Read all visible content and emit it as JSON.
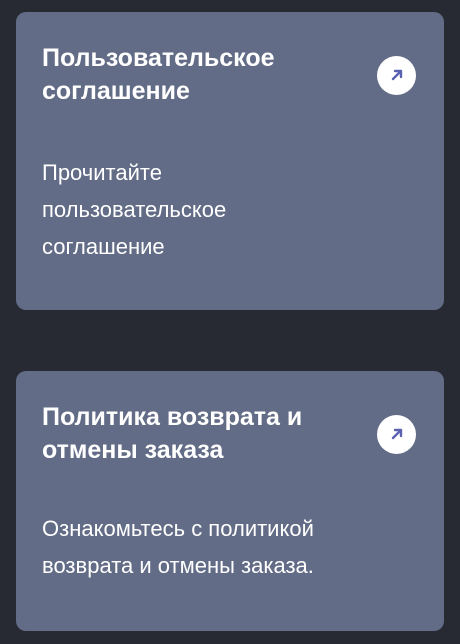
{
  "cards": [
    {
      "title": "Пользовательское соглашение",
      "description": "Прочитайте пользовательское соглашение",
      "icon": "arrow-up-right-icon"
    },
    {
      "title": "Политика возврата и отмены заказа",
      "description": "Ознакомьтесь с политикой возврата и отмены заказа.",
      "icon": "arrow-up-right-icon"
    }
  ],
  "colors": {
    "background": "#272a33",
    "card": "#636c86",
    "text": "#ffffff",
    "icon_accent": "#5b63b0"
  }
}
